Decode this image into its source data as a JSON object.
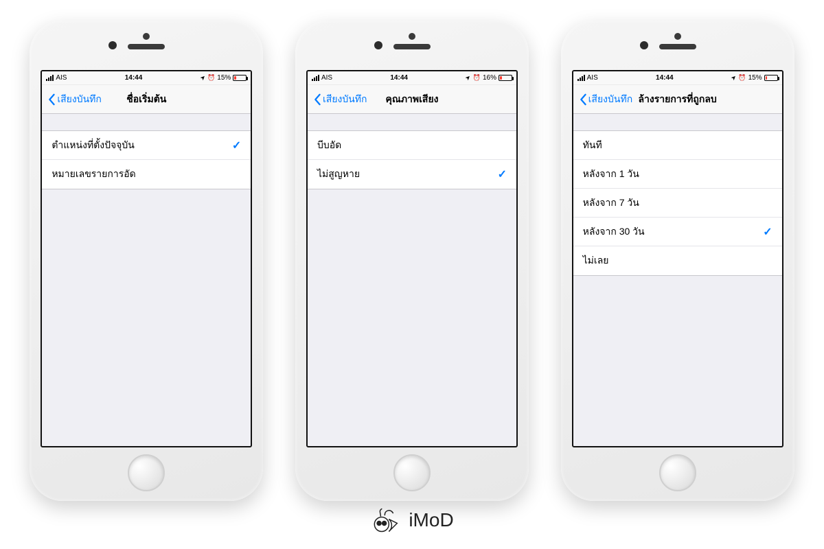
{
  "brand_text": "iMoD",
  "phones": [
    {
      "status": {
        "carrier": "AIS",
        "time": "14:44",
        "battery_pct": "15%",
        "battery_fill": "15%"
      },
      "nav": {
        "back_label": "เสียงบันทึก",
        "title": "ชื่อเริ่มต้น"
      },
      "rows": [
        {
          "label": "ตำแหน่งที่ตั้งปัจจุบัน",
          "checked": true
        },
        {
          "label": "หมายเลขรายการอัด",
          "checked": false
        }
      ]
    },
    {
      "status": {
        "carrier": "AIS",
        "time": "14:44",
        "battery_pct": "16%",
        "battery_fill": "16%"
      },
      "nav": {
        "back_label": "เสียงบันทึก",
        "title": "คุณภาพเสียง"
      },
      "rows": [
        {
          "label": "บีบอัด",
          "checked": false
        },
        {
          "label": "ไม่สูญหาย",
          "checked": true
        }
      ]
    },
    {
      "status": {
        "carrier": "AIS",
        "time": "14:44",
        "battery_pct": "15%",
        "battery_fill": "15%"
      },
      "nav": {
        "back_label": "เสียงบันทึก",
        "title": "ล้างรายการที่ถูกลบ"
      },
      "rows": [
        {
          "label": "ทันที",
          "checked": false
        },
        {
          "label": "หลังจาก 1 วัน",
          "checked": false
        },
        {
          "label": "หลังจาก 7 วัน",
          "checked": false
        },
        {
          "label": "หลังจาก 30 วัน",
          "checked": true
        },
        {
          "label": "ไม่เลย",
          "checked": false
        }
      ]
    }
  ]
}
